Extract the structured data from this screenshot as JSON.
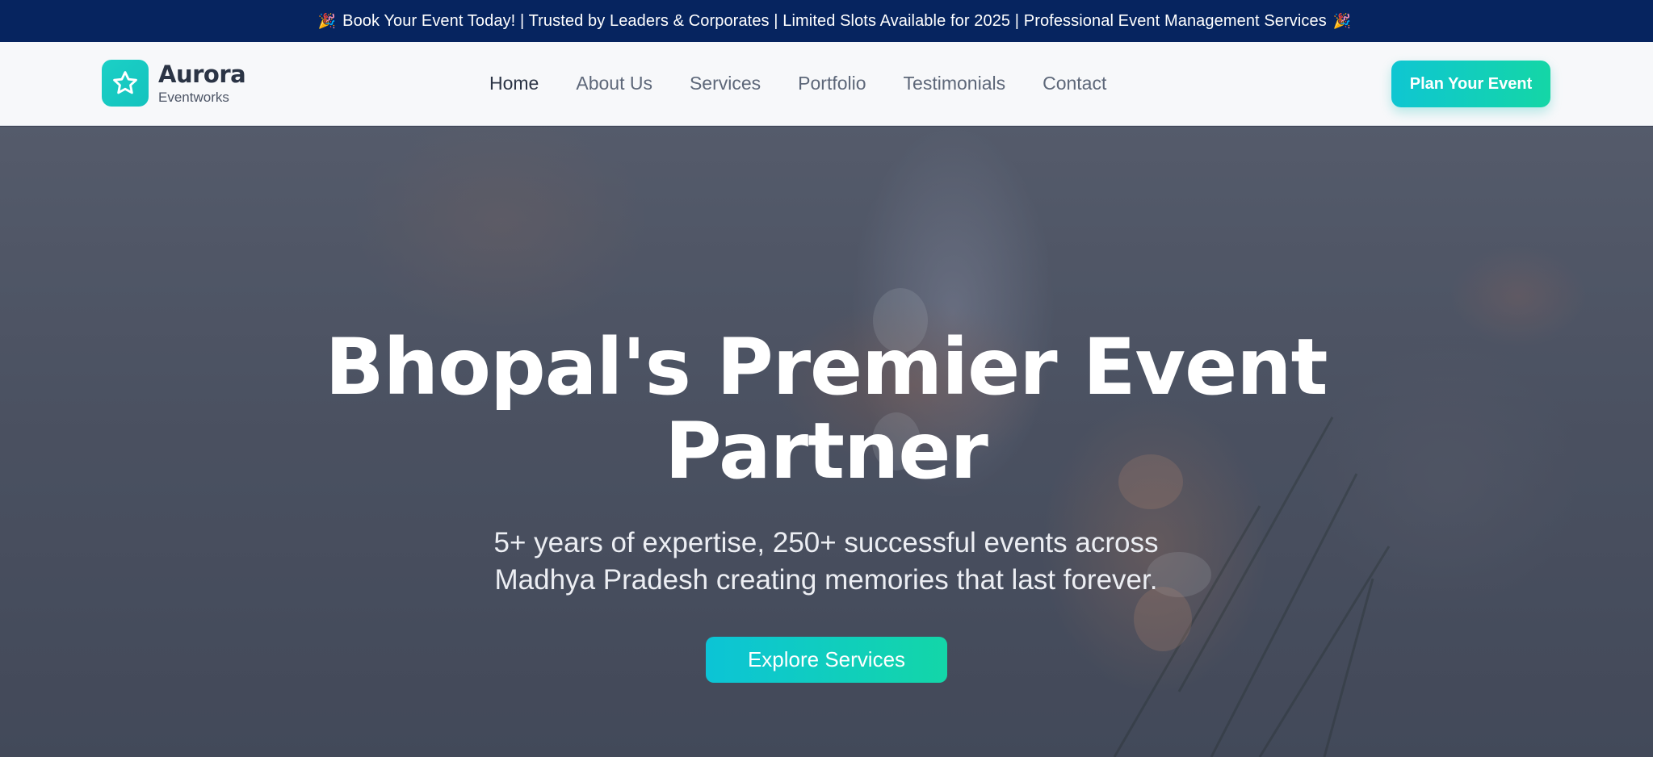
{
  "announcement": {
    "leading_emoji": "🎉",
    "text": "Book Your Event Today! | Trusted by Leaders & Corporates | Limited Slots Available for 2025 | Professional Event Management Services",
    "trailing_emoji": "🎉"
  },
  "brand": {
    "name": "Aurora",
    "subtitle": "Eventworks",
    "icon": "star-icon"
  },
  "nav": {
    "items": [
      {
        "label": "Home",
        "active": true
      },
      {
        "label": "About Us",
        "active": false
      },
      {
        "label": "Services",
        "active": false
      },
      {
        "label": "Portfolio",
        "active": false
      },
      {
        "label": "Testimonials",
        "active": false
      },
      {
        "label": "Contact",
        "active": false
      }
    ],
    "cta_label": "Plan Your Event"
  },
  "hero": {
    "title_line1": "Bhopal's Premier Event",
    "title_line2": "Partner",
    "subtitle_line1": "5+ years of expertise, 250+ successful events across",
    "subtitle_line2": "Madhya Pradesh creating memories that last forever.",
    "cta_label": "Explore Services"
  },
  "colors": {
    "announcement_bg": "#06245f",
    "nav_bg": "#f7f8fa",
    "accent_start": "#0fc6d2",
    "accent_end": "#14d6a6",
    "text_dark": "#2b3445",
    "text_muted": "#5d6779"
  }
}
